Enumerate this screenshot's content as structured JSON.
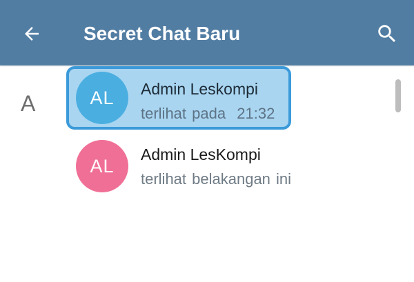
{
  "header": {
    "title": "Secret Chat Baru",
    "back_icon": "arrow-left-icon",
    "search_icon": "search-icon",
    "background_color": "#527da3"
  },
  "contacts_section": {
    "letter": "A"
  },
  "contacts": [
    {
      "initials": "AL",
      "name": "Admin Leskompi",
      "status": "terlihat pada  21:32",
      "avatar_color": "#4aaee0",
      "selected": true
    },
    {
      "initials": "AL",
      "name": "Admin LesKompi",
      "status": "terlihat belakangan ini",
      "avatar_color": "#f06f96",
      "selected": false
    }
  ],
  "highlight": {
    "background_color": "#a9d5f1",
    "border_color": "#3b9ad9"
  }
}
